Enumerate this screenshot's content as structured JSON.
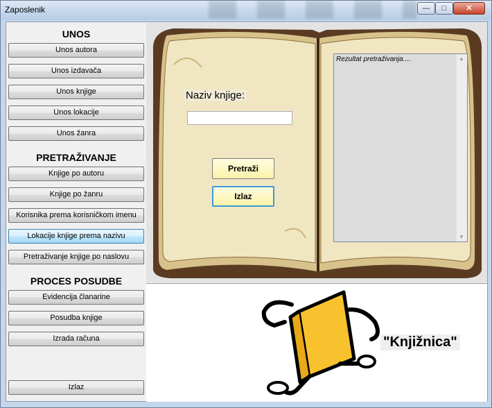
{
  "window": {
    "title": "Zaposlenik",
    "controls": {
      "minimize": "—",
      "maximize": "□",
      "close": "✕"
    }
  },
  "menu": {
    "unos": {
      "heading": "UNOS",
      "items": [
        "Unos autora",
        "Unos izdavača",
        "Unos knjige",
        "Unos lokacije",
        "Unos žanra"
      ]
    },
    "pretrazivanje": {
      "heading": "PRETRAŽIVANJE",
      "items": [
        "Knjige po autoru",
        "Knjige po žanru",
        "Korisnika prema korisničkom imenu",
        "Lokacije knjige prema nazivu",
        "Pretraživanje knjige po naslovu"
      ]
    },
    "posudba": {
      "heading": "PROCES POSUDBE",
      "items": [
        "Evidencija članarine",
        "Posudba knjige",
        "Izrada računa"
      ]
    },
    "exit_label": "Izlaz"
  },
  "search_form": {
    "field_label": "Naziv knjige:",
    "field_value": "",
    "search_button": "Pretraži",
    "exit_button": "Izlaz"
  },
  "results": {
    "text": "Rezultat pretraživanja...."
  },
  "branding": {
    "label": "\"Knjižnica\""
  },
  "colors": {
    "button_yellow": "#fbf2a8",
    "book_page": "#f0e6c2",
    "book_cover": "#5a3b22",
    "mascot": "#f7c22e"
  }
}
